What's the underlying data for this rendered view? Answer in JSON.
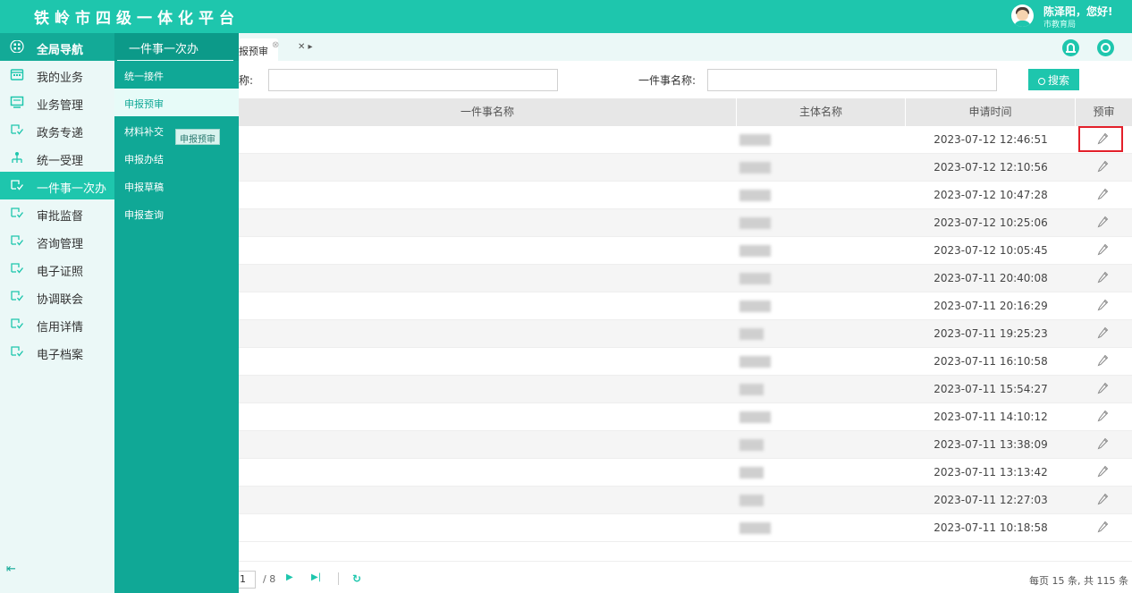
{
  "app": {
    "title": "铁岭市四级一体化平台"
  },
  "user": {
    "greeting": "陈泽阳，您好!",
    "dept": "市教育局"
  },
  "nav": {
    "head": "全局导航",
    "items": [
      {
        "label": "我的业务",
        "icon": "calendar-icon"
      },
      {
        "label": "业务管理",
        "icon": "monitor-icon"
      },
      {
        "label": "政务专递",
        "icon": "doc-check-icon"
      },
      {
        "label": "统一受理",
        "icon": "org-tree-icon"
      },
      {
        "label": "一件事一次办",
        "icon": "doc-check-icon",
        "active": true
      },
      {
        "label": "审批监督",
        "icon": "doc-check-icon"
      },
      {
        "label": "咨询管理",
        "icon": "doc-check-icon"
      },
      {
        "label": "电子证照",
        "icon": "doc-check-icon"
      },
      {
        "label": "协调联会",
        "icon": "doc-check-icon"
      },
      {
        "label": "信用详情",
        "icon": "doc-check-icon"
      },
      {
        "label": "电子档案",
        "icon": "doc-check-icon"
      }
    ],
    "collapse": "⇤"
  },
  "subnav": {
    "title": "一件事一次办",
    "items": [
      "统一接件",
      "申报预审",
      "材料补交",
      "申报办结",
      "申报草稿",
      "申报查询"
    ],
    "active_index": 1,
    "tooltip": "申报预审"
  },
  "tabs": {
    "active_label": "报预审",
    "close": "⊗",
    "scroll_label": "✕ ▸"
  },
  "search": {
    "label1": "称:",
    "label2": "一件事名称:",
    "value1": "",
    "value2": "",
    "button": "搜索"
  },
  "table": {
    "columns": [
      "一件事名称",
      "主体名称",
      "申请时间",
      "预审"
    ],
    "rows": [
      {
        "time": "2023-07-12 12:46:51"
      },
      {
        "time": "2023-07-12 12:10:56"
      },
      {
        "time": "2023-07-12 10:47:28"
      },
      {
        "time": "2023-07-12 10:25:06"
      },
      {
        "time": "2023-07-12 10:05:45"
      },
      {
        "time": "2023-07-11 20:40:08"
      },
      {
        "time": "2023-07-11 20:16:29"
      },
      {
        "time": "2023-07-11 19:25:23"
      },
      {
        "time": "2023-07-11 16:10:58"
      },
      {
        "time": "2023-07-11 15:54:27"
      },
      {
        "time": "2023-07-11 14:10:12"
      },
      {
        "time": "2023-07-11 13:38:09"
      },
      {
        "time": "2023-07-11 13:13:42"
      },
      {
        "time": "2023-07-11 12:27:03"
      },
      {
        "time": "2023-07-11 10:18:58"
      }
    ]
  },
  "pager": {
    "current": "1",
    "total": "/ 8",
    "summary": "每页 15 条, 共 115 条"
  },
  "colors": {
    "accent": "#1ec6ad",
    "accent_dark": "#10a896",
    "highlight": "#e3202a"
  }
}
